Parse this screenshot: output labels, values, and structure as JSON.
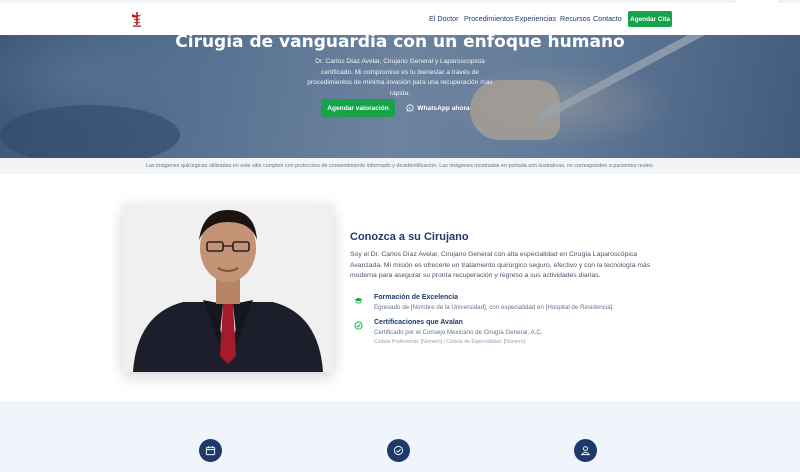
{
  "nav": {
    "logo_icon": "caduceus-logo-icon",
    "links": [
      "El Doctor",
      "Procedimientos",
      "Experiencias",
      "Recursos",
      "Contacto"
    ],
    "cta": "Agendar Cita"
  },
  "hero": {
    "title": "Cirugía de vanguardia con un enfoque humano",
    "subtitle": "Dr. Carlos Díaz Avelar, Cirujano General y Laparoscopista certificado. Mi compromiso es tu bienestar a través de procedimientos de mínima invasión para una recuperación más rápida.",
    "primary_button": "Agendar valoración",
    "secondary_button": "WhatsApp ahora",
    "secondary_icon": "whatsapp-icon"
  },
  "disclaimer": "Las imágenes quirúrgicas utilizadas en este sitio cumplen con protocolos de consentimiento informado y desidentificación. Las imágenes mostradas en portada son ilustrativas, no corresponden a pacientes reales.",
  "about": {
    "title": "Conozca a su Cirujano",
    "text": "Soy el Dr. Carlos Díaz Avelar, Cirujano General con alta especialidad en Cirugía Laparoscópica Avanzada. Mi misión es ofrecerle un tratamiento quirúrgico seguro, efectivo y con la tecnología más moderna para asegurar su pronta recuperación y regreso a sus actividades diarias.",
    "features": [
      {
        "icon": "graduation-cap-icon",
        "title": "Formación de Excelencia",
        "desc": "Egresado de [Nombre de la Universidad], con especialidad en [Hospital de Residencia].",
        "meta": ""
      },
      {
        "icon": "check-circle-icon",
        "title": "Certificaciones que Avalan",
        "desc": "Certificado por el Consejo Mexicano de Cirugía General, A.C.",
        "meta": "Cédula Profesional: [Número] | Cédula de Especialidad: [Número]"
      }
    ]
  },
  "stats": {
    "icons": [
      "calendar-icon",
      "check-badge-icon",
      "patient-icon"
    ]
  },
  "colors": {
    "navy": "#1e3a6b",
    "green": "#16a34a",
    "stats_bg": "#f0f5fc"
  }
}
